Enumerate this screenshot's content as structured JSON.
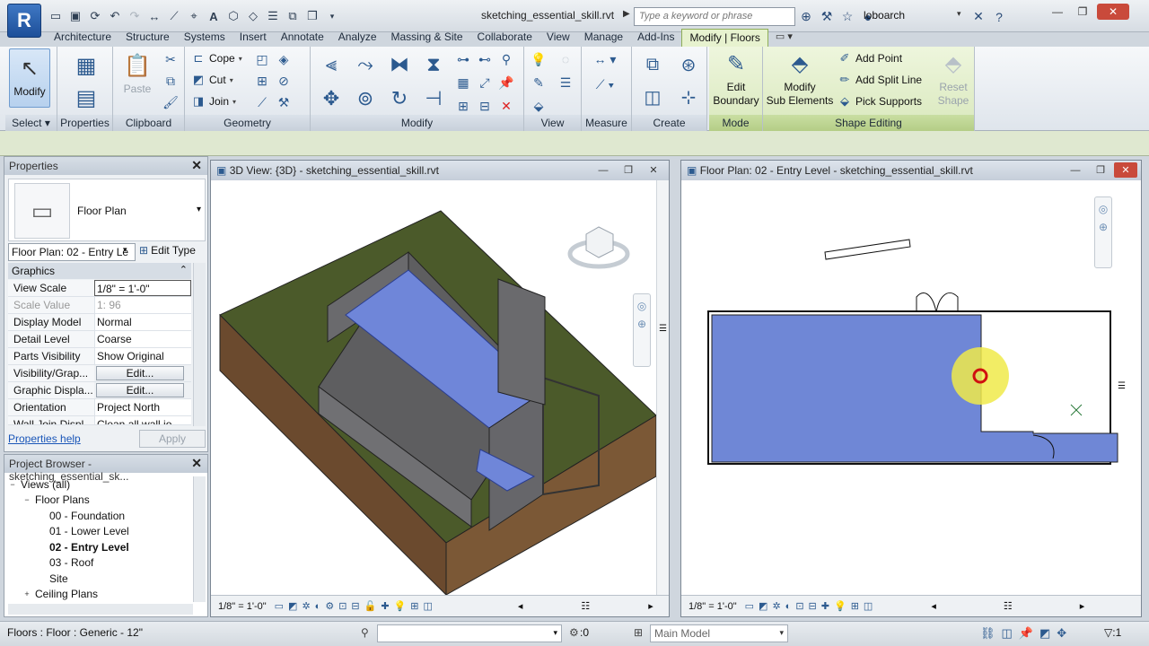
{
  "app": {
    "logo": "R",
    "document_title": "sketching_essential_skill.rvt",
    "search_placeholder": "Type a keyword or phrase",
    "user": "loboarch",
    "icons": [
      "open-icon",
      "save-icon",
      "sync-icon",
      "undo-icon",
      "redo-icon",
      "measure-icon",
      "dimension-icon",
      "tag-icon",
      "text-icon",
      "3d-icon",
      "section-icon",
      "thin-lines-icon",
      "close-hidden-icon",
      "switch-windows-icon"
    ]
  },
  "ribbon": {
    "tabs": [
      "Architecture",
      "Structure",
      "Systems",
      "Insert",
      "Annotate",
      "Analyze",
      "Massing & Site",
      "Collaborate",
      "View",
      "Manage",
      "Add-Ins",
      "Modify | Floors"
    ],
    "active_tab": "Modify | Floors",
    "panels": {
      "select": {
        "title": "Select",
        "modify_label": "Modify"
      },
      "properties": {
        "title": "Properties"
      },
      "clipboard": {
        "title": "Clipboard",
        "paste_label": "Paste"
      },
      "geometry": {
        "title": "Geometry",
        "cope_label": "Cope",
        "cut_label": "Cut",
        "join_label": "Join"
      },
      "modify": {
        "title": "Modify"
      },
      "view": {
        "title": "View"
      },
      "measure": {
        "title": "Measure"
      },
      "create": {
        "title": "Create"
      },
      "mode": {
        "title": "Mode",
        "edit_boundary_label": "Edit\nBoundary"
      },
      "shape_editing": {
        "title": "Shape Editing",
        "modify_sub_label": "Modify\nSub Elements",
        "add_point_label": "Add Point",
        "add_split_line_label": "Add Split Line",
        "pick_supports_label": "Pick Supports",
        "reset_shape_label": "Reset\nShape"
      }
    }
  },
  "properties": {
    "title": "Properties",
    "type_name": "Floor Plan",
    "instance": "Floor Plan: 02 - Entry Le",
    "edit_type": "Edit Type",
    "group": "Graphics",
    "rows": [
      {
        "key": "View Scale",
        "value": "1/8\" = 1'-0\""
      },
      {
        "key": "Scale Value",
        "value": "1:  96"
      },
      {
        "key": "Display Model",
        "value": "Normal"
      },
      {
        "key": "Detail Level",
        "value": "Coarse"
      },
      {
        "key": "Parts Visibility",
        "value": "Show Original"
      },
      {
        "key": "Visibility/Grap...",
        "value": "Edit..."
      },
      {
        "key": "Graphic Displa...",
        "value": "Edit..."
      },
      {
        "key": "Orientation",
        "value": "Project North"
      },
      {
        "key": "Wall Join Displ...",
        "value": "Clean all wall jo"
      }
    ],
    "help_link": "Properties help",
    "apply": "Apply"
  },
  "browser": {
    "title": "Project Browser - sketching_essential_sk...",
    "nodes": [
      {
        "label": "Views (all)",
        "level": 0,
        "toggle": "−"
      },
      {
        "label": "Floor Plans",
        "level": 1,
        "toggle": "−"
      },
      {
        "label": "00 - Foundation",
        "level": 2,
        "toggle": ""
      },
      {
        "label": "01 - Lower Level",
        "level": 2,
        "toggle": ""
      },
      {
        "label": "02 - Entry Level",
        "level": 2,
        "toggle": "",
        "bold": true
      },
      {
        "label": "03 - Roof",
        "level": 2,
        "toggle": ""
      },
      {
        "label": "Site",
        "level": 2,
        "toggle": ""
      },
      {
        "label": "Ceiling Plans",
        "level": 1,
        "toggle": "+"
      }
    ]
  },
  "view3d": {
    "title": "3D View: {3D} - sketching_essential_skill.rvt",
    "scale": "1/8\" = 1'-0\""
  },
  "floorplan": {
    "title": "Floor Plan: 02 - Entry Level - sketching_essential_skill.rvt",
    "scale": "1/8\" = 1'-0\"",
    "floor_color": "#6f87d6"
  },
  "status": {
    "text": "Floors : Floor : Generic - 12\"",
    "zero": ":0",
    "model": "Main Model",
    "filter": ":1"
  }
}
